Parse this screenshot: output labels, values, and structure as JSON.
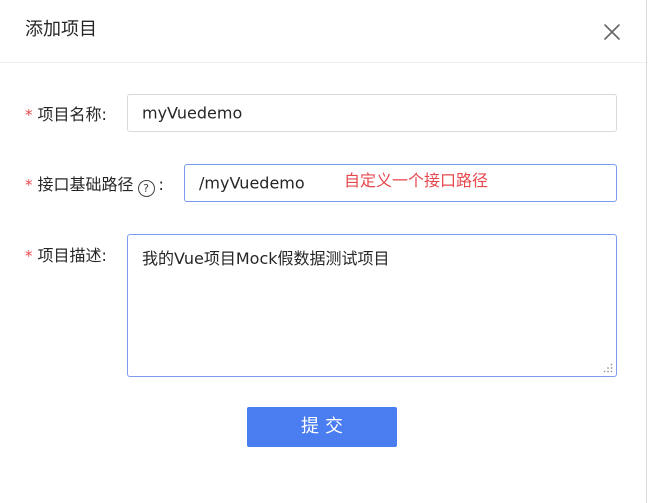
{
  "dialog": {
    "title": "添加项目",
    "close_icon": "close-icon"
  },
  "form": {
    "required_mark": "*",
    "project_name": {
      "label": "项目名称:",
      "value": "myVuedemo"
    },
    "base_path": {
      "label": "接口基础路径",
      "label_suffix": ":",
      "help_icon": "question-circle-icon",
      "help_glyph": "?",
      "value": "/myVuedemo",
      "annotation": "自定义一个接口路径"
    },
    "description": {
      "label": "项目描述:",
      "value": "我的Vue项目Mock假数据测试项目"
    },
    "submit_label": "提交"
  },
  "colors": {
    "primary": "#4a7df0",
    "required": "#e5484d",
    "focus_border": "#7b9cf0"
  }
}
